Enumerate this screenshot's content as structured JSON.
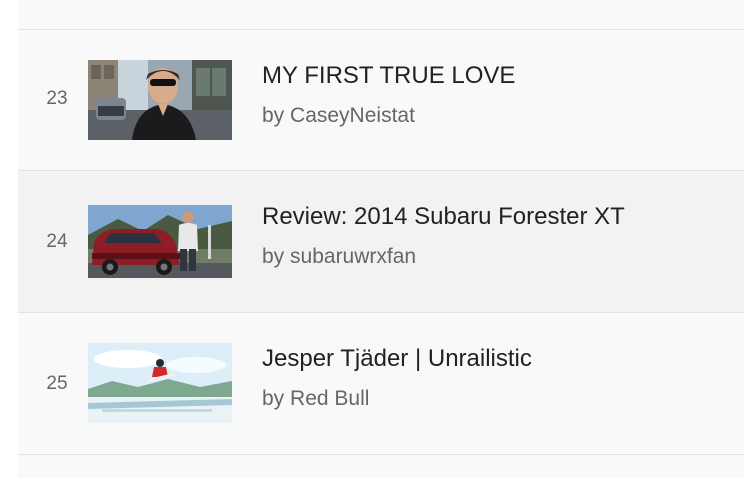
{
  "videos": [
    {
      "rank": "23",
      "title": "MY FIRST TRUE LOVE",
      "by_prefix": "by",
      "channel": "CaseyNeistat",
      "thumb_icon": "street-vlog-thumbnail"
    },
    {
      "rank": "24",
      "title": "Review: 2014 Subaru Forester XT",
      "by_prefix": "by",
      "channel": "subaruwrxfan",
      "thumb_icon": "red-suv-thumbnail"
    },
    {
      "rank": "25",
      "title": "Jesper Tjäder | Unrailistic",
      "by_prefix": "by",
      "channel": "Red Bull",
      "thumb_icon": "snowboard-jump-thumbnail"
    }
  ],
  "colors": {
    "row_bg": "#f9f9f9",
    "row_alt_bg": "#f2f2f2",
    "divider": "#e2e2e2",
    "title_text": "#222222",
    "meta_text": "#666666"
  }
}
